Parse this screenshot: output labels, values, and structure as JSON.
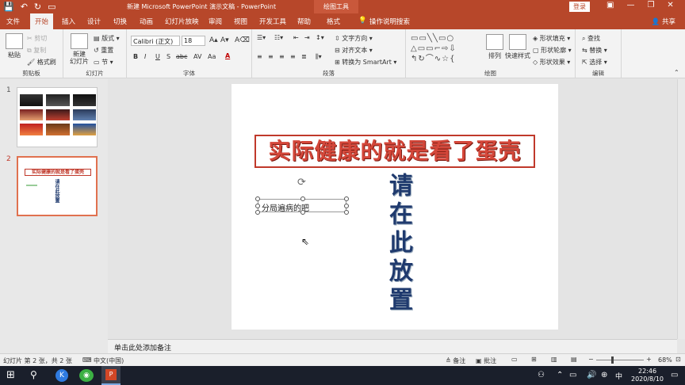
{
  "window": {
    "title": "新建 Microsoft PowerPoint 演示文稿 - PowerPoint",
    "context_tab": "绘图工具",
    "login": "登录"
  },
  "tabs": [
    "文件",
    "开始",
    "插入",
    "设计",
    "切换",
    "动画",
    "幻灯片放映",
    "审阅",
    "视图",
    "开发工具",
    "帮助",
    "格式"
  ],
  "active_tab": "开始",
  "search_hint": "操作说明搜索",
  "share": "共享",
  "ribbon": {
    "clipboard": {
      "paste": "粘贴",
      "cut": "剪切",
      "copy": "复制",
      "format_painter": "格式刷",
      "label": "剪贴板"
    },
    "slides": {
      "new_slide": "新建\n幻灯片",
      "layout": "版式",
      "reset": "重置",
      "section": "节",
      "label": "幻灯片"
    },
    "font": {
      "name": "Calibri (正文)",
      "size": "18",
      "bold": "B",
      "italic": "I",
      "underline": "U",
      "strike": "S",
      "shadow": "abc",
      "spacing": "AV",
      "case": "Aa",
      "color": "A",
      "label": "字体"
    },
    "paragraph": {
      "text_direction": "文字方向",
      "align_text": "对齐文本",
      "smartart": "转换为 SmartArt",
      "label": "段落"
    },
    "drawing": {
      "arrange": "排列",
      "quick_styles": "快速样式",
      "fill": "形状填充",
      "outline": "形状轮廓",
      "effects": "形状效果",
      "label": "绘图"
    },
    "editing": {
      "find": "查找",
      "replace": "替换",
      "select": "选择",
      "label": "编辑"
    }
  },
  "thumbnails": [
    {
      "number": "1"
    },
    {
      "number": "2",
      "title": "实际健康的就是看了蛋壳",
      "vertical": "请在此放置"
    }
  ],
  "slide": {
    "title": "实际健康的就是看了蛋壳",
    "textbox": "分局遍病的吧",
    "vertical_text": "请在此放置"
  },
  "notes_placeholder": "单击此处添加备注",
  "status": {
    "slide_info": "幻灯片 第 2 张，共 2 张",
    "language": "中文(中国)",
    "notes": "备注",
    "comments": "批注",
    "zoom": "68%"
  },
  "taskbar": {
    "time": "22:46",
    "date": "2020/8/10",
    "ime": "中"
  },
  "colors": {
    "accent": "#b7472a",
    "title_red": "#c0392b",
    "vertical_blue": "#1f3a6e"
  }
}
